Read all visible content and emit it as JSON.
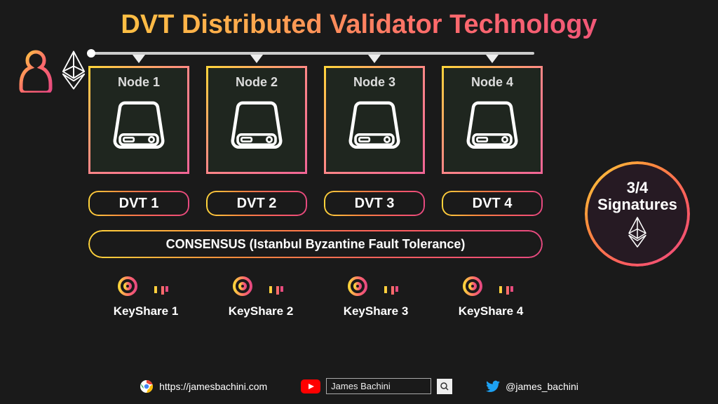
{
  "title": "DVT Distributed Validator Technology",
  "nodes": [
    {
      "label": "Node 1"
    },
    {
      "label": "Node 2"
    },
    {
      "label": "Node 3"
    },
    {
      "label": "Node 4"
    }
  ],
  "dvt": [
    {
      "label": "DVT 1"
    },
    {
      "label": "DVT 2"
    },
    {
      "label": "DVT 3"
    },
    {
      "label": "DVT 4"
    }
  ],
  "consensus": "CONSENSUS (Istanbul Byzantine Fault Tolerance)",
  "keyshares": [
    {
      "label": "KeyShare 1"
    },
    {
      "label": "KeyShare 2"
    },
    {
      "label": "KeyShare 3"
    },
    {
      "label": "KeyShare 4"
    }
  ],
  "signatures": {
    "line1": "3/4",
    "line2": "Signatures"
  },
  "footer": {
    "site": "https://jamesbachini.com",
    "search_value": "James Bachini",
    "twitter": "@james_bachini"
  }
}
